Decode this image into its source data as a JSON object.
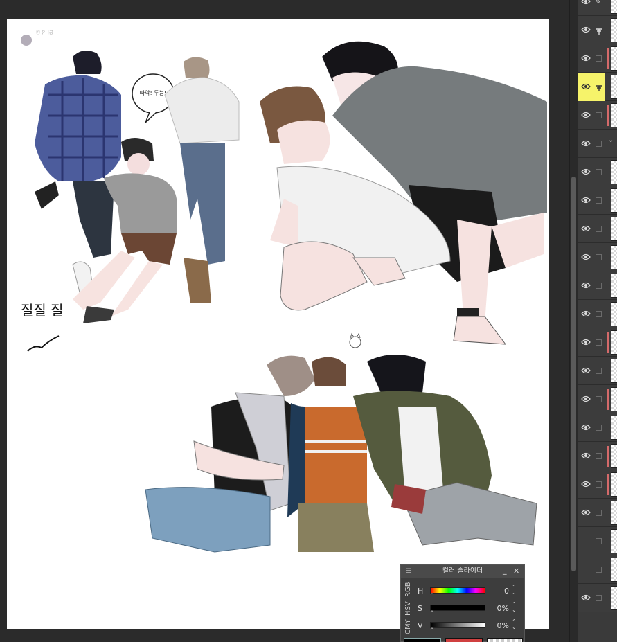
{
  "canvas": {
    "doodle_text": "질질 질",
    "speech_bubble_text": "따악! 두붕!",
    "signature_text": "Ⓒ 유니곰"
  },
  "color_slider": {
    "title": "컬러 슬라이더",
    "tabs": [
      "RGB",
      "HSV",
      "CMY"
    ],
    "rows": [
      {
        "label": "H",
        "value": "0"
      },
      {
        "label": "S",
        "value": "0%"
      },
      {
        "label": "V",
        "value": "0%"
      }
    ],
    "minimize_label": "_",
    "close_label": "✕",
    "main_color": "#000000",
    "sub_color": "#d04040"
  },
  "layers": {
    "active_index": 2,
    "rows": [
      {
        "icon": "pen-icon",
        "visible": true
      },
      {
        "icon": "pin-icon",
        "visible": true
      },
      {
        "icon": "layer",
        "visible": true,
        "marked": true
      },
      {
        "icon": "pin-icon",
        "visible": true,
        "active": true
      },
      {
        "icon": "layer",
        "visible": true,
        "marked": true
      },
      {
        "icon": "folder",
        "visible": true
      },
      {
        "icon": "layer",
        "visible": true
      },
      {
        "icon": "layer",
        "visible": true
      },
      {
        "icon": "layer",
        "visible": true
      },
      {
        "icon": "layer",
        "visible": true
      },
      {
        "icon": "layer",
        "visible": true
      },
      {
        "icon": "layer",
        "visible": true
      },
      {
        "icon": "layer",
        "visible": true,
        "marked": true
      },
      {
        "icon": "layer",
        "visible": true
      },
      {
        "icon": "layer",
        "visible": true,
        "marked": true
      },
      {
        "icon": "layer",
        "visible": true
      },
      {
        "icon": "layer",
        "visible": true,
        "marked": true
      },
      {
        "icon": "layer",
        "visible": true,
        "marked": true
      },
      {
        "icon": "layer",
        "visible": true
      },
      {
        "icon": "layer",
        "visible": false
      },
      {
        "icon": "layer",
        "visible": false
      },
      {
        "icon": "layer",
        "visible": true
      }
    ]
  }
}
